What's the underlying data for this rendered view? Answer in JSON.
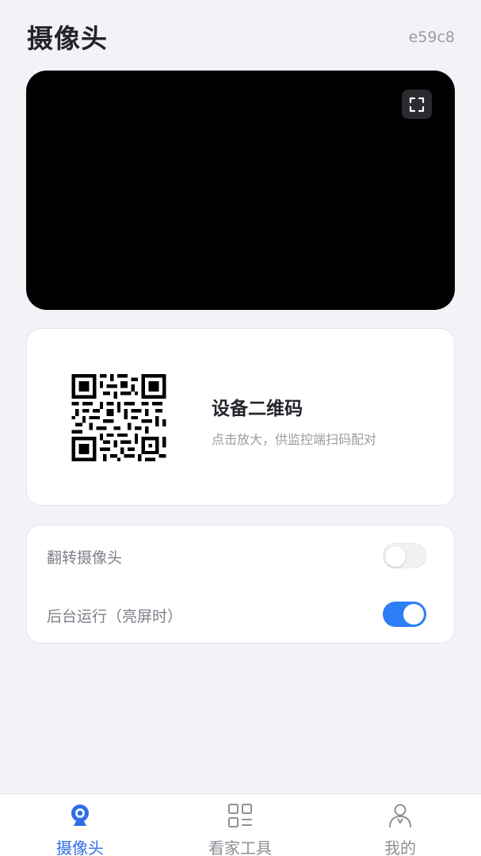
{
  "header": {
    "title": "摄像头",
    "device_id": "e59c8"
  },
  "preview": {
    "fullscreen_icon": "fullscreen-icon"
  },
  "qr_card": {
    "title": "设备二维码",
    "subtitle": "点击放大，供监控端扫码配对"
  },
  "settings": {
    "items": [
      {
        "label": "翻转摄像头",
        "enabled": false
      },
      {
        "label": "后台运行（亮屏时）",
        "enabled": true
      }
    ]
  },
  "nav": {
    "items": [
      {
        "label": "摄像头",
        "icon": "camera-icon",
        "active": true
      },
      {
        "label": "看家工具",
        "icon": "grid-tools-icon",
        "active": false
      },
      {
        "label": "我的",
        "icon": "person-icon",
        "active": false
      }
    ]
  },
  "colors": {
    "accent": "#2e7ef5",
    "background": "#f2f3f7"
  }
}
